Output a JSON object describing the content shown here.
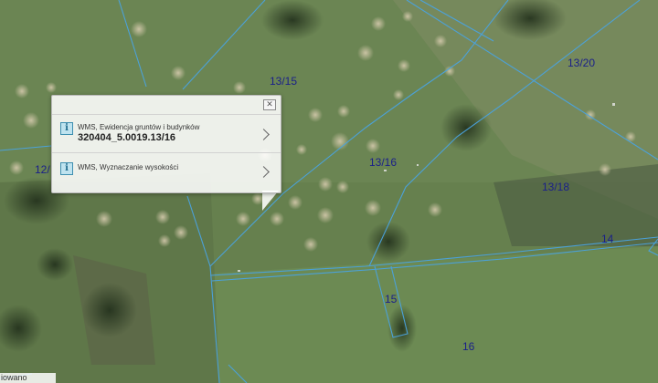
{
  "map": {
    "parcels": [
      {
        "id": "p1315",
        "label": "13/15"
      },
      {
        "id": "p1320",
        "label": "13/20"
      },
      {
        "id": "p1316",
        "label": "13/16"
      },
      {
        "id": "p1318",
        "label": "13/18"
      },
      {
        "id": "p14",
        "label": "14"
      },
      {
        "id": "p15",
        "label": "15"
      },
      {
        "id": "p16",
        "label": "16"
      },
      {
        "id": "p12",
        "label": "12/"
      }
    ],
    "boundary_color": "#4aa3e0",
    "label_color": "#1a1f8a"
  },
  "popup": {
    "close_icon": "close-icon",
    "items": [
      {
        "icon": "info-icon",
        "title": "WMS, Ewidencja gruntów i budynków",
        "value": "320404_5.0019.13/16"
      },
      {
        "icon": "info-icon",
        "title": "WMS, Wyznaczanie wysokości"
      }
    ]
  },
  "footer": {
    "corner_text": "iowano"
  }
}
